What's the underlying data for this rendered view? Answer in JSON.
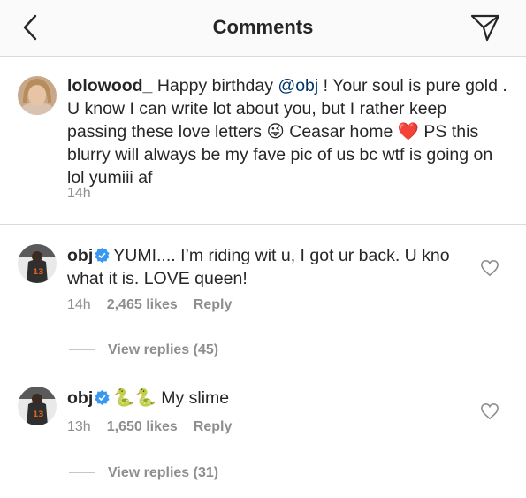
{
  "header": {
    "title": "Comments",
    "back_icon": "chevron-left-icon",
    "share_icon": "paper-plane-icon"
  },
  "caption": {
    "username": "lolowood_",
    "text_before_mention": " Happy birthday ",
    "mention": "@obj",
    "text_after_mention": " ! Your soul is pure gold . U know I can write lot about you, but I rather keep passing these love letters ",
    "emoji_1": "😜",
    "text_middle": " Ceasar home ",
    "emoji_2": "❤️",
    "text_end": " PS this blurry will always be my fave pic of us bc wtf is going on lol yumiii af",
    "time": "14h"
  },
  "comments": [
    {
      "username": "obj",
      "text": "YUMI.... I’m riding wit u, I got ur back. U kno what it is. LOVE queen!",
      "time": "14h",
      "likes": "2,465 likes",
      "reply": "Reply",
      "view_replies": "View replies (45)"
    },
    {
      "username": "obj",
      "emoji": "🐍🐍",
      "text": "My slime",
      "time": "13h",
      "likes": "1,650 likes",
      "reply": "Reply",
      "view_replies": "View replies (31)"
    }
  ],
  "colors": {
    "mention": "#003569",
    "secondary_text": "#8e8e8e",
    "verified": "#3897f0",
    "emoji_heart": "#e0245e",
    "snake_green": "#77b255"
  }
}
